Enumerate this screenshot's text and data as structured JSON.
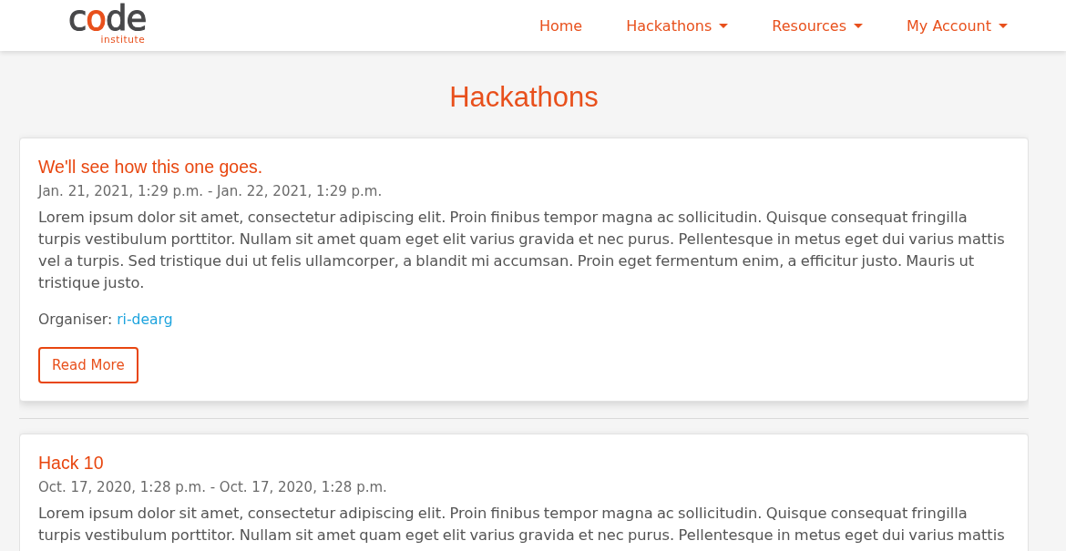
{
  "navbar": {
    "logo": {
      "word_parts": [
        {
          "text": "c",
          "accent": false
        },
        {
          "text": "o",
          "accent": true
        },
        {
          "text": "de",
          "accent": false
        }
      ],
      "tagline": "institute"
    },
    "links": [
      {
        "label": "Home",
        "dropdown": false
      },
      {
        "label": "Hackathons",
        "dropdown": true
      },
      {
        "label": "Resources",
        "dropdown": true
      },
      {
        "label": "My Account",
        "dropdown": true
      }
    ]
  },
  "page_title": "Hackathons",
  "hackathons": [
    {
      "title": "We'll see how this one goes.",
      "dates": "Jan. 21, 2021, 1:29 p.m. - Jan. 22, 2021, 1:29 p.m.",
      "description": "Lorem ipsum dolor sit amet, consectetur adipiscing elit. Proin finibus tempor magna ac sollicitudin. Quisque consequat fringilla turpis vestibulum porttitor. Nullam sit amet quam eget elit varius gravida et nec purus. Pellentesque in metus eget dui varius mattis vel a turpis. Sed tristique dui ut felis ullamcorper, a blandit mi accumsan. Proin eget fermentum enim, a efficitur justo. Mauris ut tristique justo.",
      "organiser": {
        "label": "Organiser:",
        "name": "ri-dearg"
      },
      "button": "Read More"
    },
    {
      "title": "Hack 10",
      "dates": "Oct. 17, 2020, 1:28 p.m. - Oct. 17, 2020, 1:28 p.m.",
      "description": "Lorem ipsum dolor sit amet, consectetur adipiscing elit. Proin finibus tempor magna ac sollicitudin. Quisque consequat fringilla turpis vestibulum porttitor. Nullam sit amet quam eget elit varius gravida et nec purus. Pellentesque in metus eget dui varius mattis"
    }
  ]
}
